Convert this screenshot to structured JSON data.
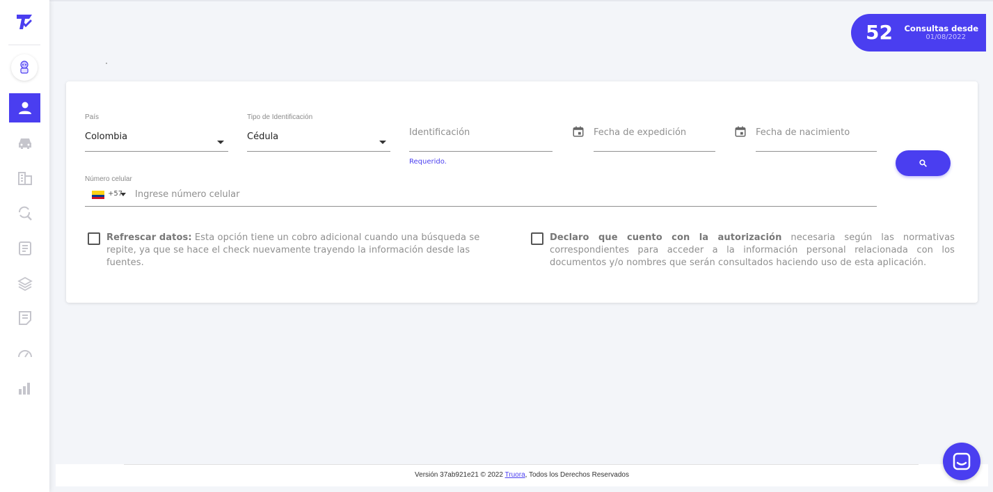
{
  "badge": {
    "count": "52",
    "label": "Consultas desde",
    "date": "01/08/2022"
  },
  "form": {
    "country": {
      "label": "País",
      "value": "Colombia"
    },
    "id_type": {
      "label": "Tipo de Identificación",
      "value": "Cédula"
    },
    "identification": {
      "placeholder": "Identificación",
      "error": "Requerido."
    },
    "expedition_date": {
      "placeholder": "Fecha de expedición"
    },
    "birth_date": {
      "placeholder": "Fecha de nacimiento"
    },
    "phone": {
      "label": "Número celular",
      "dial_code": "+57",
      "placeholder": "Ingrese número celular"
    }
  },
  "checkboxes": [
    {
      "bold": "Refrescar datos:",
      "text": " Esta opción tiene un cobro adicional cuando una búsqueda se repite, ya que se hace el check nuevamente trayendo la información desde las fuentes."
    },
    {
      "bold": "Declaro que cuento con la autorización",
      "text": " necesaria según las normativas correspondientes para acceder a la información personal relacionada con los documentos y/o nombres que serán consultados haciendo uso de esta aplicación."
    }
  ],
  "footer": {
    "prefix": "Versión 37ab921e21 © 2022 ",
    "link": "Truora",
    "suffix": ", Todos los Derechos Reservados"
  },
  "sidebar": {
    "items": [
      {
        "icon": "person-icon",
        "active": true
      },
      {
        "icon": "car-icon",
        "active": false
      },
      {
        "icon": "buildings-icon",
        "active": false
      },
      {
        "icon": "search-refresh-icon",
        "active": false
      },
      {
        "icon": "document-list-icon",
        "active": false
      },
      {
        "icon": "layers-icon",
        "active": false
      },
      {
        "icon": "notes-icon",
        "active": false
      },
      {
        "icon": "speedometer-icon",
        "active": false
      },
      {
        "icon": "bar-chart-icon",
        "active": false
      }
    ]
  },
  "colors": {
    "accent": "#4a3ef0",
    "background": "#f3f5f9"
  }
}
